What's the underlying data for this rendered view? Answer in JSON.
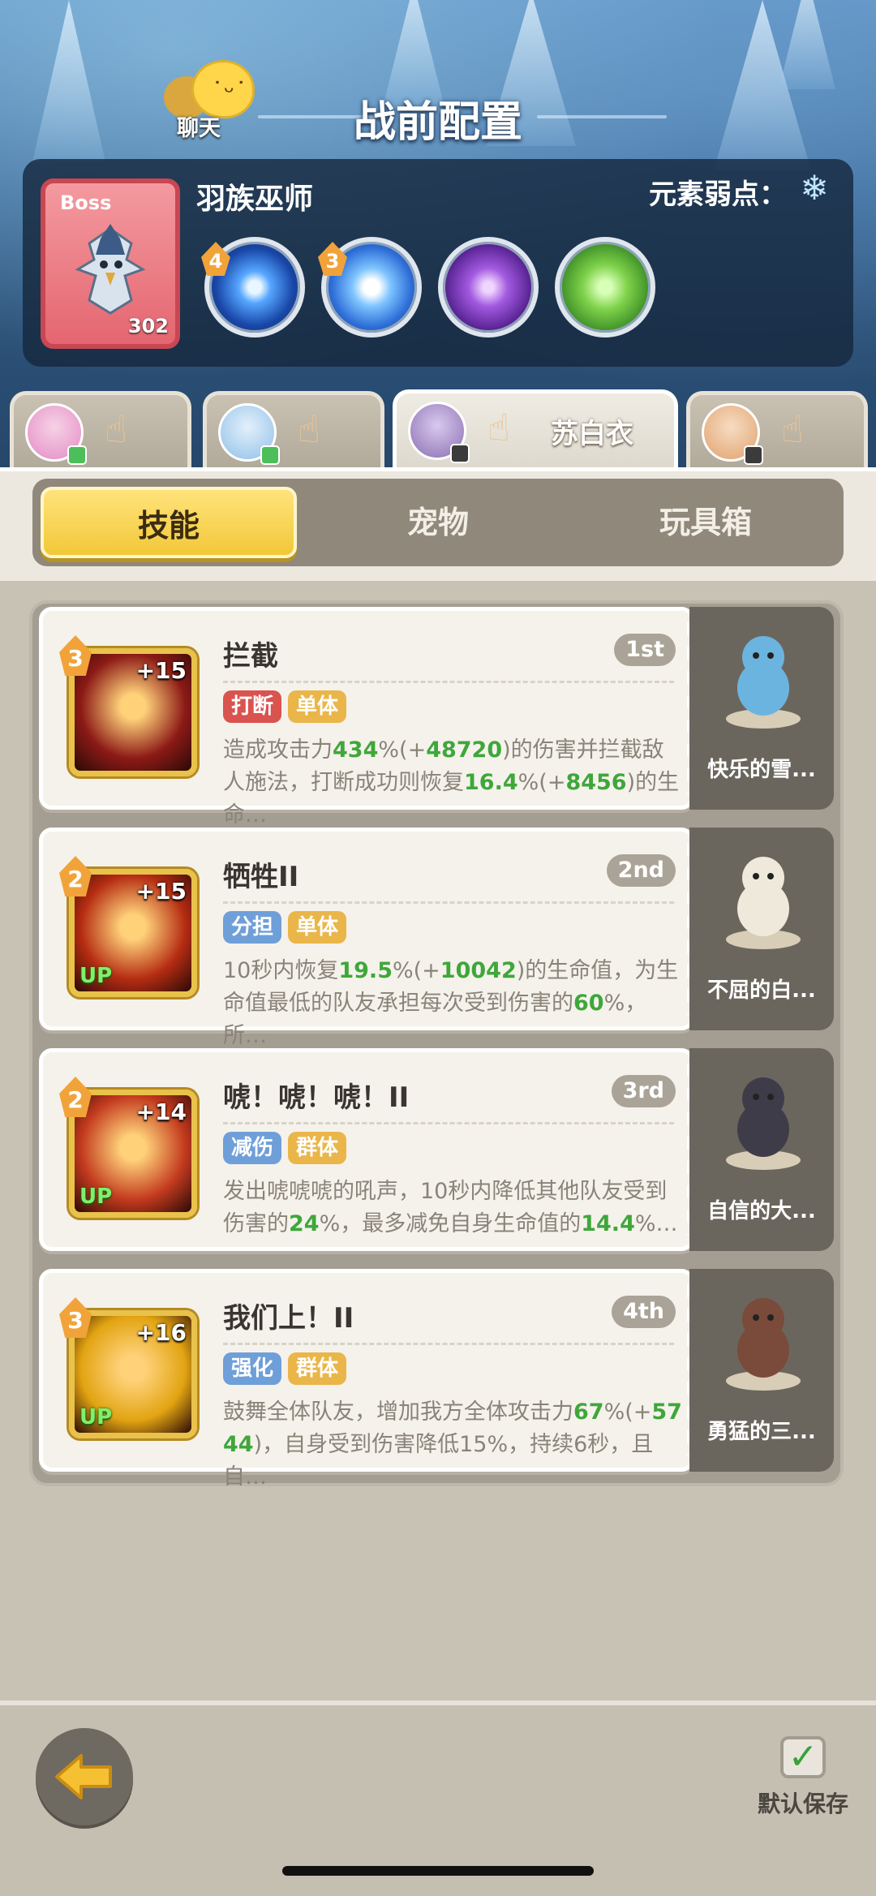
{
  "header": {
    "chat_label": "聊天",
    "title": "战前配置"
  },
  "boss": {
    "tag": "Boss",
    "level": "302",
    "name": "羽族巫师",
    "weakness_label": "元素弱点：",
    "weakness_icon": "snowflake-icon",
    "skills": [
      {
        "badge": "4",
        "icon": "blue-orb-icon",
        "color": "#2f74d6"
      },
      {
        "badge": "3",
        "icon": "blue-burst-icon",
        "color": "#3a86e6"
      },
      {
        "badge": "",
        "icon": "purple-flame-icon",
        "color": "#7a3fb8"
      },
      {
        "badge": "",
        "icon": "green-slime-icon",
        "color": "#4fae3c"
      }
    ]
  },
  "heroes": [
    {
      "name": "",
      "avatar_color": "#e48bc4",
      "badge": "green"
    },
    {
      "name": "",
      "avatar_color": "#8fc0e8",
      "badge": "green"
    },
    {
      "name": "苏白衣",
      "avatar_color": "#8a6fb0",
      "badge": "dark"
    },
    {
      "name": "",
      "avatar_color": "#e0a26e",
      "badge": "dark"
    }
  ],
  "tabs": [
    {
      "label": "技能",
      "active": true
    },
    {
      "label": "宠物",
      "active": false
    },
    {
      "label": "玩具箱",
      "active": false
    }
  ],
  "skills": [
    {
      "level": "3",
      "plus": "+15",
      "up": "",
      "name": "拦截",
      "order": "1st",
      "tags": [
        {
          "label": "打断",
          "color": "red"
        },
        {
          "label": "单体",
          "color": "gold"
        }
      ],
      "desc_parts": [
        {
          "t": "造成攻击力"
        },
        {
          "t": "434",
          "hl": true
        },
        {
          "t": "%(+"
        },
        {
          "t": "48720",
          "hl": true
        },
        {
          "t": ")的伤害并拦截敌人施法，打断成功则恢复"
        },
        {
          "t": "16.4",
          "hl": true
        },
        {
          "t": "%(+"
        },
        {
          "t": "8456",
          "hl": true
        },
        {
          "t": ")的生命…"
        }
      ],
      "icon_bg": "#8c1a16",
      "pet_name": "快乐的雪...",
      "pet_color": "#6cb4e0"
    },
    {
      "level": "2",
      "plus": "+15",
      "up": "UP",
      "name": "牺牲II",
      "order": "2nd",
      "tags": [
        {
          "label": "分担",
          "color": "blue"
        },
        {
          "label": "单体",
          "color": "gold"
        }
      ],
      "desc_parts": [
        {
          "t": "10秒内恢复"
        },
        {
          "t": "19.5",
          "hl": true
        },
        {
          "t": "%(+"
        },
        {
          "t": "10042",
          "hl": true
        },
        {
          "t": ")的生命值，为生命值最低的队友承担每次受到伤害的"
        },
        {
          "t": "60",
          "hl": true
        },
        {
          "t": "%，所…"
        }
      ],
      "icon_bg": "#b52c12",
      "pet_name": "不屈的白...",
      "pet_color": "#efe9dc"
    },
    {
      "level": "2",
      "plus": "+14",
      "up": "UP",
      "name": "唬！唬！唬！II",
      "order": "3rd",
      "tags": [
        {
          "label": "减伤",
          "color": "blue"
        },
        {
          "label": "群体",
          "color": "gold"
        }
      ],
      "desc_parts": [
        {
          "t": "发出唬唬唬的吼声，10秒内降低其他队友受到伤害的"
        },
        {
          "t": "24",
          "hl": true
        },
        {
          "t": "%，最多减免自身生命值的"
        },
        {
          "t": "14.4",
          "hl": true
        },
        {
          "t": "%…"
        }
      ],
      "icon_bg": "#c33a1e",
      "pet_name": "自信的大...",
      "pet_color": "#3f3c4a"
    },
    {
      "level": "3",
      "plus": "+16",
      "up": "UP",
      "name": "我们上！II",
      "order": "4th",
      "tags": [
        {
          "label": "强化",
          "color": "blue"
        },
        {
          "label": "群体",
          "color": "gold"
        }
      ],
      "desc_parts": [
        {
          "t": "鼓舞全体队友，增加我方全体攻击力"
        },
        {
          "t": "67",
          "hl": true
        },
        {
          "t": "%(+"
        },
        {
          "t": "5744",
          "hl": true
        },
        {
          "t": ")，自身受到伤害降低15%，持续6秒，且自…"
        }
      ],
      "icon_bg": "#e2a412",
      "pet_name": "勇猛的三...",
      "pet_color": "#7a4a3a"
    }
  ],
  "footer": {
    "back_icon": "back-arrow-icon",
    "save_label": "默认保存",
    "save_checked": true
  }
}
